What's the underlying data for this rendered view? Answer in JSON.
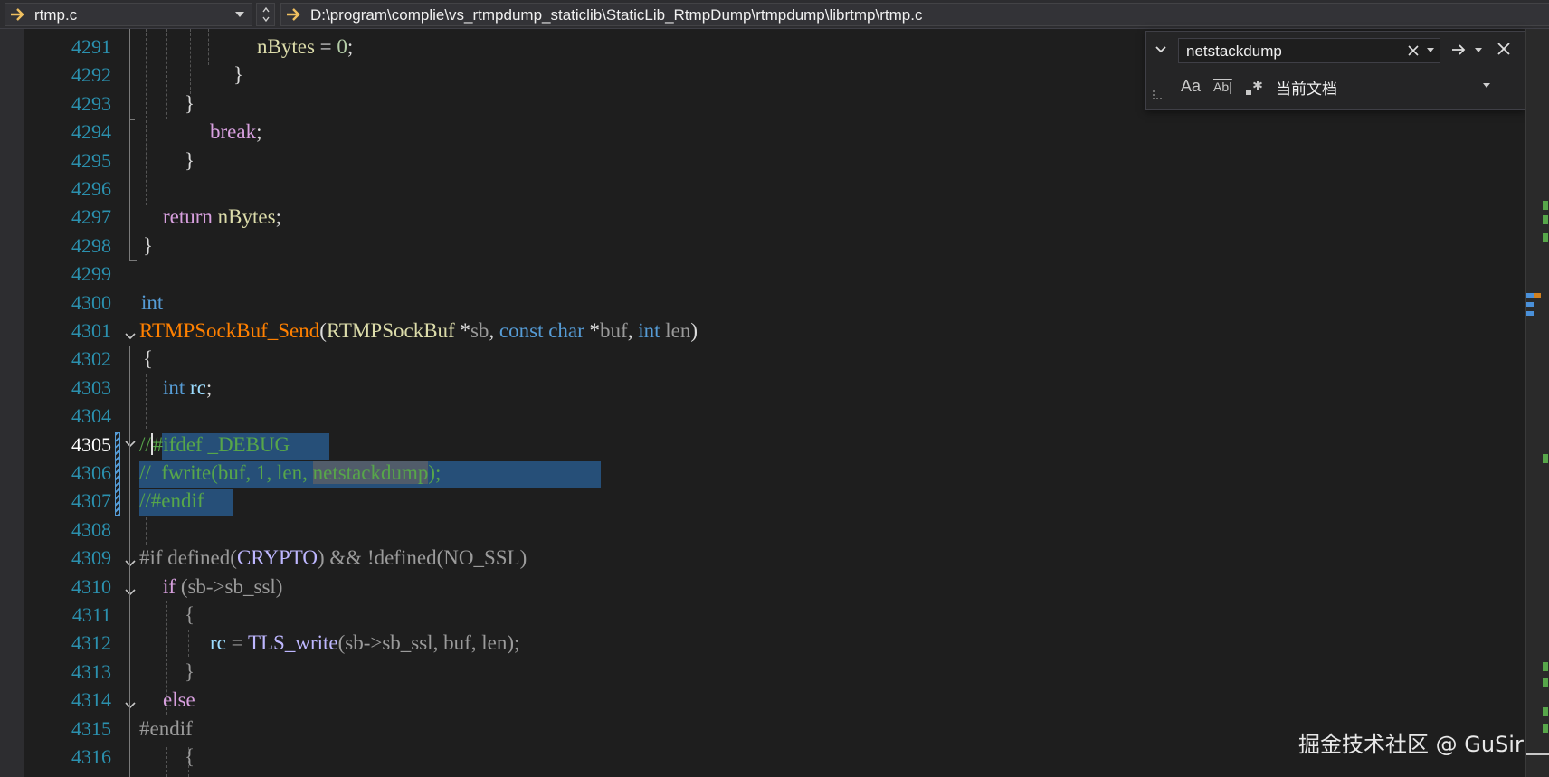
{
  "navbar": {
    "file_name": "rtmp.c",
    "file_path": "D:\\program\\complie\\vs_rtmpdump_staticlib\\StaticLib_RtmpDump\\rtmpdump\\librtmp\\rtmp.c"
  },
  "editor": {
    "current_line": "4305",
    "line_numbers": [
      "4291",
      "4292",
      "4293",
      "4294",
      "4295",
      "4296",
      "4297",
      "4298",
      "4299",
      "4300",
      "4301",
      "4302",
      "4303",
      "4304",
      "4305",
      "4306",
      "4307",
      "4308",
      "4309",
      "4310",
      "4311",
      "4312",
      "4313",
      "4314",
      "4315",
      "4316"
    ],
    "code": {
      "l4291_a": "nBytes",
      "l4291_b": " = ",
      "l4291_c": "0",
      "l4291_d": ";",
      "l4292": "}",
      "l4293": "}",
      "l4294_a": "break",
      "l4294_b": ";",
      "l4295": "}",
      "l4297_a": "return",
      "l4297_b": " nBytes",
      "l4297_c": ";",
      "l4298": "}",
      "l4300": "int",
      "l4301_fn": "RTMPSockBuf_Send",
      "l4301_p1": "(",
      "l4301_ty": "RTMPSockBuf",
      "l4301_p2": " *",
      "l4301_sb": "sb",
      "l4301_p3": ", ",
      "l4301_const": "const",
      "l4301_sp1": " ",
      "l4301_char": "char",
      "l4301_p4": " *",
      "l4301_buf": "buf",
      "l4301_p5": ", ",
      "l4301_int": "int",
      "l4301_sp2": " ",
      "l4301_len": "len",
      "l4301_p6": ")",
      "l4302": "{",
      "l4303_a": "int",
      "l4303_b": " rc",
      "l4303_c": ";",
      "l4305_a": "//",
      "l4305_b": "#ifdef _DEBUG",
      "l4306_a": "//  fwrite(buf, 1, len, ",
      "l4306_b": "netstackdump",
      "l4306_c": ");",
      "l4307": "//#endif",
      "l4309_a": "#if defined(",
      "l4309_b": "CRYPTO",
      "l4309_c": ") && !defined(NO_SSL)",
      "l4310_a": "if",
      "l4310_b": " (sb->sb_ssl)",
      "l4311": "{",
      "l4312_a": "rc",
      "l4312_b": " = ",
      "l4312_c": "TLS_write",
      "l4312_d": "(sb->sb_ssl, buf, len);",
      "l4313": "}",
      "l4314": "else",
      "l4315": "#endif",
      "l4316": "{"
    }
  },
  "find": {
    "search_value": "netstackdump",
    "match_case_label": "Aa",
    "whole_word_label": "Ab|",
    "scope": "当前文档"
  },
  "watermark": "掘金技术社区 @ GuSir",
  "colors": {
    "background": "#1e1e1e",
    "line_number": "#2b91af",
    "keyword": "#569cd6",
    "control": "#d8a0df",
    "function": "#dcdcaa",
    "type": "#4ec9b0",
    "comment": "#57a64a",
    "selection": "#264f78"
  },
  "icons": [
    "arrow-right-icon",
    "chevron-down-icon",
    "spin-updown-icon",
    "close-icon",
    "regex-icon",
    "grip-icon",
    "fold-chevron-icon"
  ]
}
